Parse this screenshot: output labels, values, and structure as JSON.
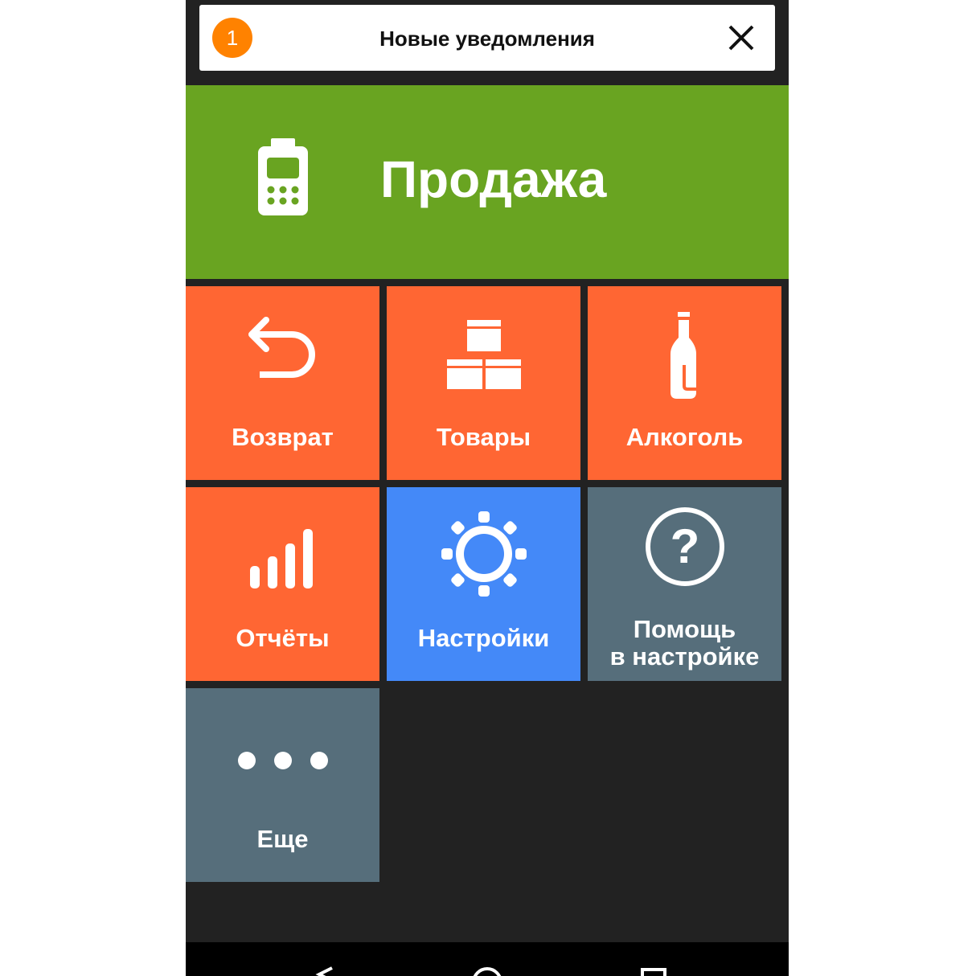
{
  "notification": {
    "count": "1",
    "title": "Новые уведомления",
    "close_icon": "close-icon",
    "badge_color": "#ff8200"
  },
  "sale": {
    "label": "Продажа",
    "icon": "cash-register-icon",
    "color": "#69a421"
  },
  "tiles": [
    {
      "label": "Возврат",
      "icon": "return-arrow-icon",
      "color": "#ff6633"
    },
    {
      "label": "Товары",
      "icon": "boxes-icon",
      "color": "#ff6633"
    },
    {
      "label": "Алкоголь",
      "icon": "bottle-icon",
      "color": "#ff6633"
    },
    {
      "label": "Отчёты",
      "icon": "bar-chart-icon",
      "color": "#ff6633"
    },
    {
      "label": "Настройки",
      "icon": "gear-icon",
      "color": "#4489f8"
    },
    {
      "label_line1": "Помощь",
      "label_line2": "в настройке",
      "icon": "help-icon",
      "color": "#566e7b"
    },
    {
      "label": "Еще",
      "icon": "more-dots-icon",
      "color": "#566e7b"
    }
  ],
  "navigation": {
    "back_icon": "back-icon",
    "home_icon": "home-icon",
    "recents_icon": "recents-icon"
  }
}
